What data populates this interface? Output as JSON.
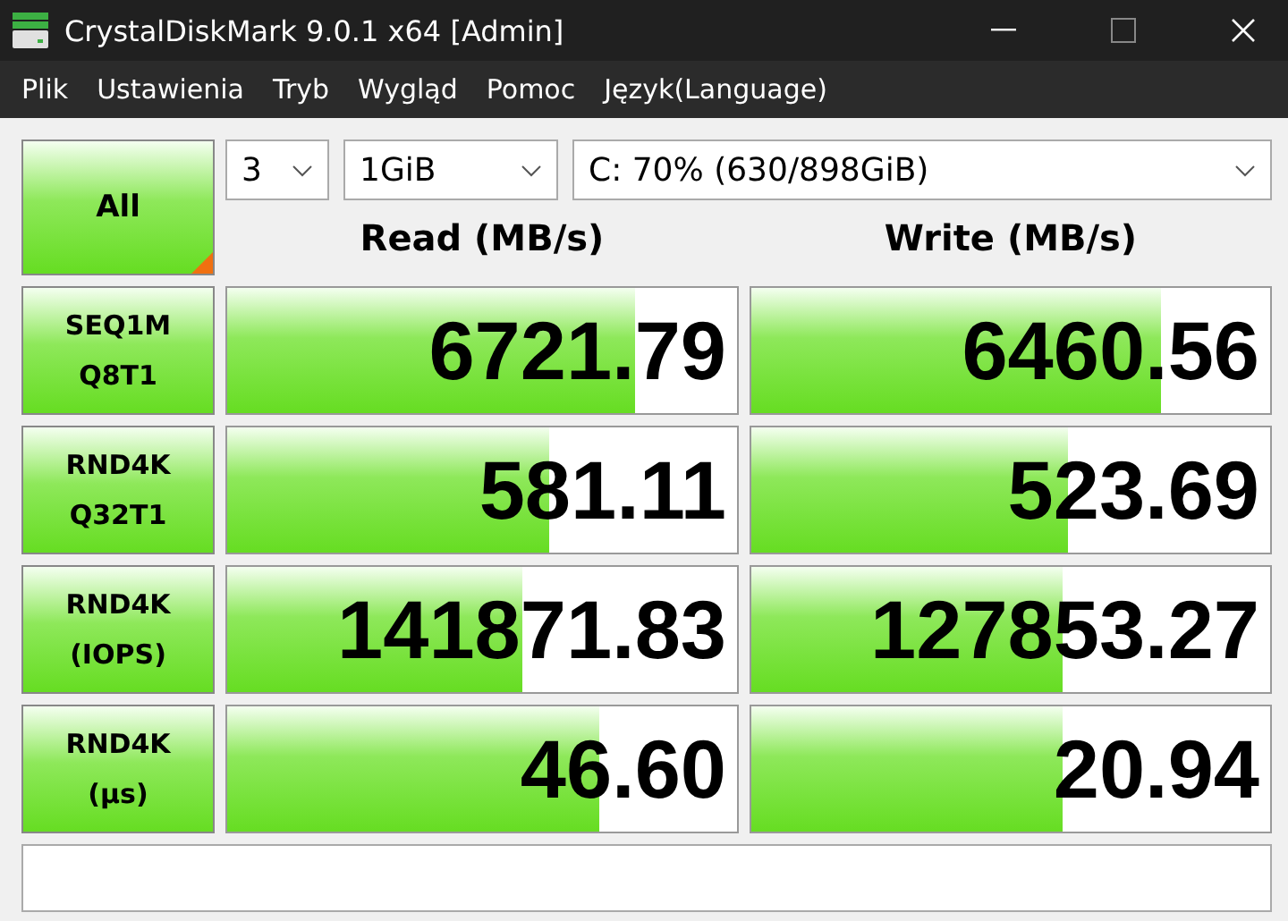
{
  "window": {
    "title": "CrystalDiskMark 9.0.1 x64 [Admin]"
  },
  "menu": [
    "Plik",
    "Ustawienia",
    "Tryb",
    "Wygląd",
    "Pomoc",
    "Język(Language)"
  ],
  "all_button": {
    "label": "All"
  },
  "selectors": {
    "count": "3",
    "size": "1GiB",
    "drive": "C: 70% (630/898GiB)"
  },
  "columns": [
    "Read (MB/s)",
    "Write (MB/s)"
  ],
  "rows": [
    {
      "test": "SEQ1M",
      "param": "Q8T1",
      "read": {
        "value": "6721.79",
        "level": 0.8
      },
      "write": {
        "value": "6460.56",
        "level": 0.79
      }
    },
    {
      "test": "RND4K",
      "param": "Q32T1",
      "read": {
        "value": "581.11",
        "level": 0.63
      },
      "write": {
        "value": "523.69",
        "level": 0.61
      }
    },
    {
      "test": "RND4K",
      "param": "(IOPS)",
      "read": {
        "value": "141871.83",
        "level": 0.58
      },
      "write": {
        "value": "127853.27",
        "level": 0.6
      }
    },
    {
      "test": "RND4K",
      "param": "(µs)",
      "read": {
        "value": "46.60",
        "level": 0.73
      },
      "write": {
        "value": "20.94",
        "level": 0.6
      }
    }
  ]
}
